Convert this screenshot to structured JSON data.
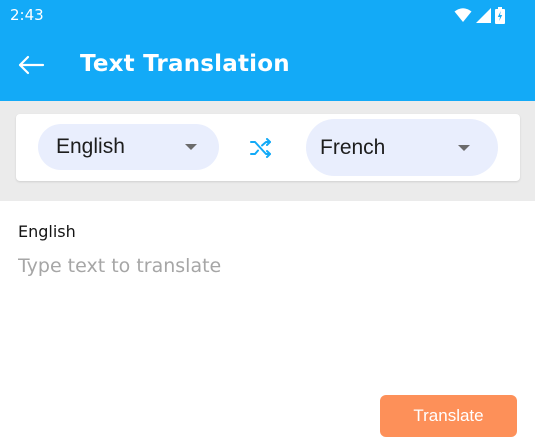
{
  "status_bar": {
    "time": "2:43",
    "icons": [
      "wifi-icon",
      "signal-icon",
      "battery-icon"
    ]
  },
  "header": {
    "title": "Text Translation",
    "back_icon": "arrow-left-icon",
    "background": "#13aaf7"
  },
  "languages": {
    "source": "English",
    "target": "French",
    "swap_icon": "shuffle-icon",
    "accent": "#13aaf7"
  },
  "input": {
    "label": "English",
    "placeholder": "Type text to translate",
    "value": ""
  },
  "actions": {
    "translate_label": "Translate",
    "translate_color": "#fd9059"
  }
}
